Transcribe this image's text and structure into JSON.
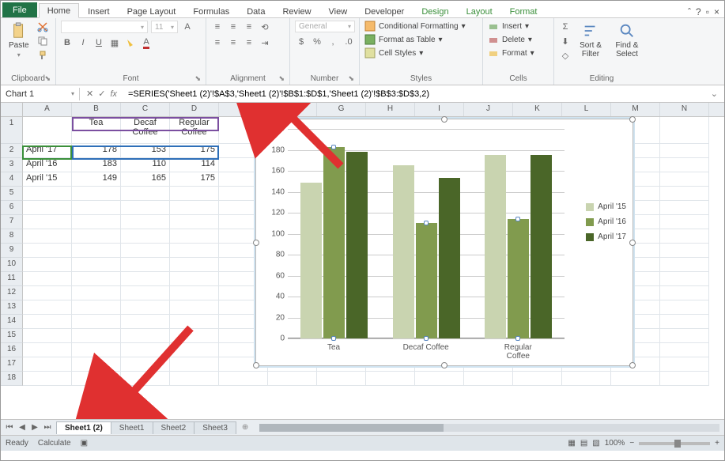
{
  "tabs": {
    "file": "File",
    "items": [
      "Home",
      "Insert",
      "Page Layout",
      "Formulas",
      "Data",
      "Review",
      "View",
      "Developer",
      "Design",
      "Layout",
      "Format"
    ],
    "active": 0
  },
  "ribbon": {
    "clipboard": {
      "paste": "Paste",
      "label": "Clipboard"
    },
    "font": {
      "name": "",
      "size": "11",
      "label": "Font"
    },
    "alignment": {
      "label": "Alignment"
    },
    "number": {
      "format": "General",
      "label": "Number"
    },
    "styles": {
      "cond": "Conditional Formatting",
      "table": "Format as Table",
      "cell": "Cell Styles",
      "label": "Styles"
    },
    "cells": {
      "insert": "Insert",
      "delete": "Delete",
      "format": "Format",
      "label": "Cells"
    },
    "editing": {
      "sort": "Sort & Filter",
      "find": "Find & Select",
      "label": "Editing"
    }
  },
  "formula": {
    "name": "Chart 1",
    "fx": "fx",
    "value": "=SERIES('Sheet1 (2)'!$A$3,'Sheet1 (2)'!$B$1:$D$1,'Sheet1 (2)'!$B$3:$D$3,2)"
  },
  "grid": {
    "cols": [
      "A",
      "B",
      "C",
      "D",
      "E",
      "F",
      "G",
      "H",
      "I",
      "J",
      "K",
      "L",
      "M",
      "N"
    ],
    "rows": [
      "1",
      "2",
      "3",
      "4",
      "5",
      "6",
      "7",
      "8",
      "9",
      "10",
      "11",
      "12",
      "13",
      "14",
      "15",
      "16",
      "17",
      "18"
    ],
    "headers": {
      "b": "Tea",
      "c1": "Decaf",
      "c2": "Coffee",
      "d1": "Regular",
      "d2": "Coffee"
    },
    "data": [
      {
        "a": "April '17",
        "b": "178",
        "c": "153",
        "d": "175"
      },
      {
        "a": "April '16",
        "b": "183",
        "c": "110",
        "d": "114"
      },
      {
        "a": "April '15",
        "b": "149",
        "c": "165",
        "d": "175"
      }
    ]
  },
  "chart_data": {
    "type": "bar",
    "categories": [
      "Tea",
      "Decaf Coffee",
      "Regular Coffee"
    ],
    "series": [
      {
        "name": "April '15",
        "values": [
          149,
          165,
          175
        ]
      },
      {
        "name": "April '16",
        "values": [
          183,
          110,
          114
        ]
      },
      {
        "name": "April '17",
        "values": [
          178,
          153,
          175
        ]
      }
    ],
    "ylim": [
      0,
      200
    ],
    "yticks": [
      0,
      20,
      40,
      60,
      80,
      100,
      120,
      140,
      160,
      180,
      200
    ],
    "colors": {
      "April '15": "#c9d4b0",
      "April '16": "#819b4e",
      "April '17": "#4a6628"
    }
  },
  "sheets": {
    "tabs": [
      "Sheet1 (2)",
      "Sheet1",
      "Sheet2",
      "Sheet3"
    ],
    "active": 0
  },
  "status": {
    "ready": "Ready",
    "calc": "Calculate",
    "zoom": "100%"
  }
}
